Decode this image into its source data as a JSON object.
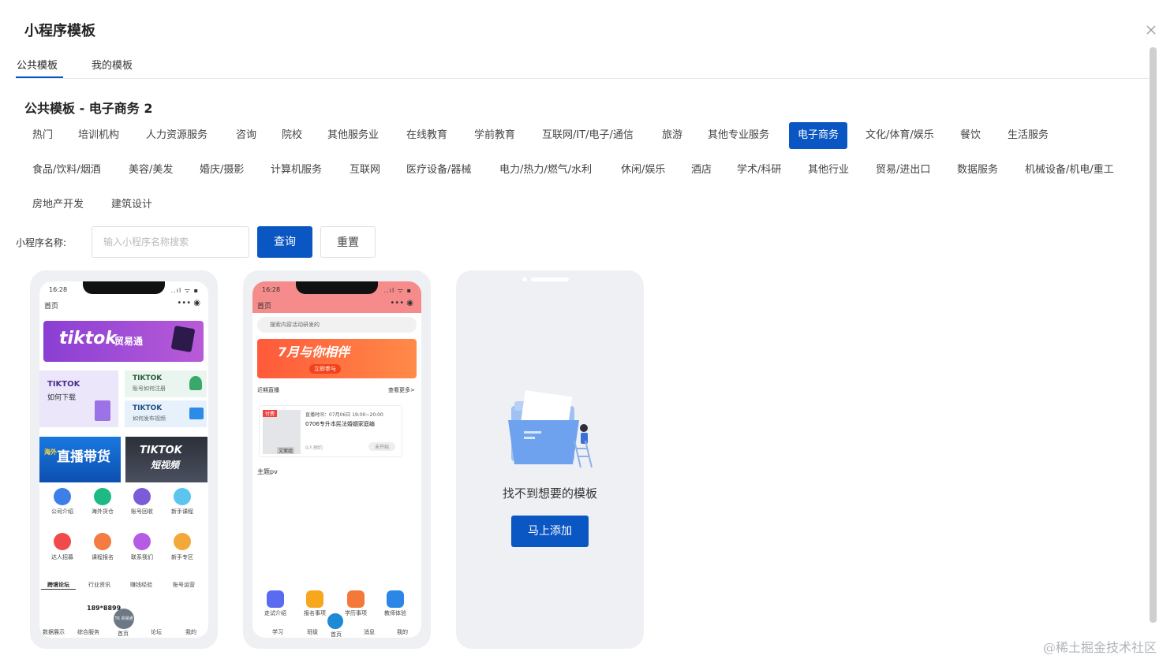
{
  "dialog": {
    "title": "小程序模板",
    "close_glyph": "×"
  },
  "tabs": [
    {
      "label": "公共模板",
      "active": true
    },
    {
      "label": "我的模板",
      "active": false
    }
  ],
  "section_title": "公共模板 - 电子商务 2",
  "categories_rows": [
    [
      "热门",
      "培训机构",
      "人力资源服务",
      "咨询",
      "院校",
      "其他服务业",
      "在线教育",
      "学前教育",
      "互联网/IT/电子/通信",
      "旅游",
      "其他专业服务",
      "电子商务",
      "文化/体育/娱乐",
      "餐饮",
      "生活服务"
    ],
    [
      "食品/饮料/烟酒",
      "美容/美发",
      "婚庆/摄影",
      "计算机服务",
      "互联网",
      "医疗设备/器械",
      "电力/热力/燃气/水利",
      "休闲/娱乐",
      "酒店",
      "学术/科研",
      "其他行业",
      "贸易/进出口",
      "数据服务",
      "机械设备/机电/重工"
    ],
    [
      "房地产开发",
      "建筑设计"
    ]
  ],
  "active_category": "电子商务",
  "search": {
    "label": "小程序名称:",
    "placeholder": "输入小程序名称搜索",
    "value": ""
  },
  "buttons": {
    "query": "查询",
    "reset": "重置",
    "add": "马上添加"
  },
  "empty_card": {
    "text": "找不到想要的模板"
  },
  "template1": {
    "time": "16:28",
    "signal": "..ıl ᯤ ▪",
    "nav_title": "首页",
    "nav_dots": "•••  ◉",
    "banner_main": "tiktok",
    "banner_sub": "贸易通",
    "grid_a_title": "TIKTOK",
    "grid_a_sub": "如何下载",
    "grid_b_title": "TIKTOK",
    "grid_b_sub": "账号如何注册",
    "grid_c_title": "TIKTOK",
    "grid_c_sub": "如何发布视频",
    "promo_left_tag": "海外",
    "promo_left": "直播带货",
    "promo_right_1": "TIKTOK",
    "promo_right_2": "短视频",
    "icons_row1": [
      "公司介绍",
      "海外货仓",
      "账号回收",
      "新手课程"
    ],
    "icons_row2": [
      "达人招募",
      "课程报名",
      "联系我们",
      "新手专区"
    ],
    "tabs": [
      "跨境论坛",
      "行业资讯",
      "赚钱经验",
      "账号运营"
    ],
    "phone_number": "189*8899",
    "center_logo": "TK 贸易通",
    "bottom_nav": [
      "数据展示",
      "综合服务",
      "首页",
      "论坛",
      "我的"
    ]
  },
  "template2": {
    "time": "16:28",
    "signal": "..ıl ᯤ ▪",
    "nav_title": "首页",
    "nav_dots": "•••  ◉",
    "search_placeholder": "搜索内容活动研发的",
    "banner_main": "7月与你相伴",
    "banner_btn": "立即参与",
    "live_title": "近期直播",
    "live_more": "查看更多>",
    "badge": "付费",
    "live_time": "直播时间：07月06日 19:00~20:00",
    "live_topic": "0706专升本民法婚姻家庭编",
    "live_count": "0人预约",
    "live_status": "未开始",
    "thumb_label": "文案组",
    "theme_title": "主题pv",
    "bottom_icons": [
      "走试介绍",
      "报名事项",
      "学历事项",
      "教师体验"
    ],
    "bottom_nav": [
      "学习",
      "班级",
      "首页",
      "消息",
      "我的"
    ]
  },
  "watermark": "@稀土掘金技术社区",
  "colors": {
    "primary": "#0a56c2",
    "card_bg": "#eef0f3",
    "banner_purple": "#7b3fd0",
    "pink_header": "#f58b8b"
  }
}
